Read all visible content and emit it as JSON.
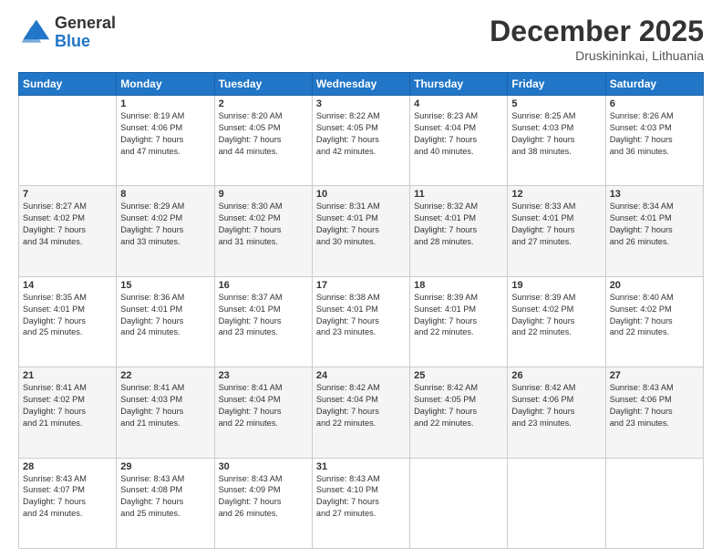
{
  "logo": {
    "general": "General",
    "blue": "Blue"
  },
  "header": {
    "month": "December 2025",
    "location": "Druskininkai, Lithuania"
  },
  "weekdays": [
    "Sunday",
    "Monday",
    "Tuesday",
    "Wednesday",
    "Thursday",
    "Friday",
    "Saturday"
  ],
  "weeks": [
    [
      {
        "day": "",
        "info": ""
      },
      {
        "day": "1",
        "info": "Sunrise: 8:19 AM\nSunset: 4:06 PM\nDaylight: 7 hours\nand 47 minutes."
      },
      {
        "day": "2",
        "info": "Sunrise: 8:20 AM\nSunset: 4:05 PM\nDaylight: 7 hours\nand 44 minutes."
      },
      {
        "day": "3",
        "info": "Sunrise: 8:22 AM\nSunset: 4:05 PM\nDaylight: 7 hours\nand 42 minutes."
      },
      {
        "day": "4",
        "info": "Sunrise: 8:23 AM\nSunset: 4:04 PM\nDaylight: 7 hours\nand 40 minutes."
      },
      {
        "day": "5",
        "info": "Sunrise: 8:25 AM\nSunset: 4:03 PM\nDaylight: 7 hours\nand 38 minutes."
      },
      {
        "day": "6",
        "info": "Sunrise: 8:26 AM\nSunset: 4:03 PM\nDaylight: 7 hours\nand 36 minutes."
      }
    ],
    [
      {
        "day": "7",
        "info": "Sunrise: 8:27 AM\nSunset: 4:02 PM\nDaylight: 7 hours\nand 34 minutes."
      },
      {
        "day": "8",
        "info": "Sunrise: 8:29 AM\nSunset: 4:02 PM\nDaylight: 7 hours\nand 33 minutes."
      },
      {
        "day": "9",
        "info": "Sunrise: 8:30 AM\nSunset: 4:02 PM\nDaylight: 7 hours\nand 31 minutes."
      },
      {
        "day": "10",
        "info": "Sunrise: 8:31 AM\nSunset: 4:01 PM\nDaylight: 7 hours\nand 30 minutes."
      },
      {
        "day": "11",
        "info": "Sunrise: 8:32 AM\nSunset: 4:01 PM\nDaylight: 7 hours\nand 28 minutes."
      },
      {
        "day": "12",
        "info": "Sunrise: 8:33 AM\nSunset: 4:01 PM\nDaylight: 7 hours\nand 27 minutes."
      },
      {
        "day": "13",
        "info": "Sunrise: 8:34 AM\nSunset: 4:01 PM\nDaylight: 7 hours\nand 26 minutes."
      }
    ],
    [
      {
        "day": "14",
        "info": "Sunrise: 8:35 AM\nSunset: 4:01 PM\nDaylight: 7 hours\nand 25 minutes."
      },
      {
        "day": "15",
        "info": "Sunrise: 8:36 AM\nSunset: 4:01 PM\nDaylight: 7 hours\nand 24 minutes."
      },
      {
        "day": "16",
        "info": "Sunrise: 8:37 AM\nSunset: 4:01 PM\nDaylight: 7 hours\nand 23 minutes."
      },
      {
        "day": "17",
        "info": "Sunrise: 8:38 AM\nSunset: 4:01 PM\nDaylight: 7 hours\nand 23 minutes."
      },
      {
        "day": "18",
        "info": "Sunrise: 8:39 AM\nSunset: 4:01 PM\nDaylight: 7 hours\nand 22 minutes."
      },
      {
        "day": "19",
        "info": "Sunrise: 8:39 AM\nSunset: 4:02 PM\nDaylight: 7 hours\nand 22 minutes."
      },
      {
        "day": "20",
        "info": "Sunrise: 8:40 AM\nSunset: 4:02 PM\nDaylight: 7 hours\nand 22 minutes."
      }
    ],
    [
      {
        "day": "21",
        "info": "Sunrise: 8:41 AM\nSunset: 4:02 PM\nDaylight: 7 hours\nand 21 minutes."
      },
      {
        "day": "22",
        "info": "Sunrise: 8:41 AM\nSunset: 4:03 PM\nDaylight: 7 hours\nand 21 minutes."
      },
      {
        "day": "23",
        "info": "Sunrise: 8:41 AM\nSunset: 4:04 PM\nDaylight: 7 hours\nand 22 minutes."
      },
      {
        "day": "24",
        "info": "Sunrise: 8:42 AM\nSunset: 4:04 PM\nDaylight: 7 hours\nand 22 minutes."
      },
      {
        "day": "25",
        "info": "Sunrise: 8:42 AM\nSunset: 4:05 PM\nDaylight: 7 hours\nand 22 minutes."
      },
      {
        "day": "26",
        "info": "Sunrise: 8:42 AM\nSunset: 4:06 PM\nDaylight: 7 hours\nand 23 minutes."
      },
      {
        "day": "27",
        "info": "Sunrise: 8:43 AM\nSunset: 4:06 PM\nDaylight: 7 hours\nand 23 minutes."
      }
    ],
    [
      {
        "day": "28",
        "info": "Sunrise: 8:43 AM\nSunset: 4:07 PM\nDaylight: 7 hours\nand 24 minutes."
      },
      {
        "day": "29",
        "info": "Sunrise: 8:43 AM\nSunset: 4:08 PM\nDaylight: 7 hours\nand 25 minutes."
      },
      {
        "day": "30",
        "info": "Sunrise: 8:43 AM\nSunset: 4:09 PM\nDaylight: 7 hours\nand 26 minutes."
      },
      {
        "day": "31",
        "info": "Sunrise: 8:43 AM\nSunset: 4:10 PM\nDaylight: 7 hours\nand 27 minutes."
      },
      {
        "day": "",
        "info": ""
      },
      {
        "day": "",
        "info": ""
      },
      {
        "day": "",
        "info": ""
      }
    ]
  ]
}
